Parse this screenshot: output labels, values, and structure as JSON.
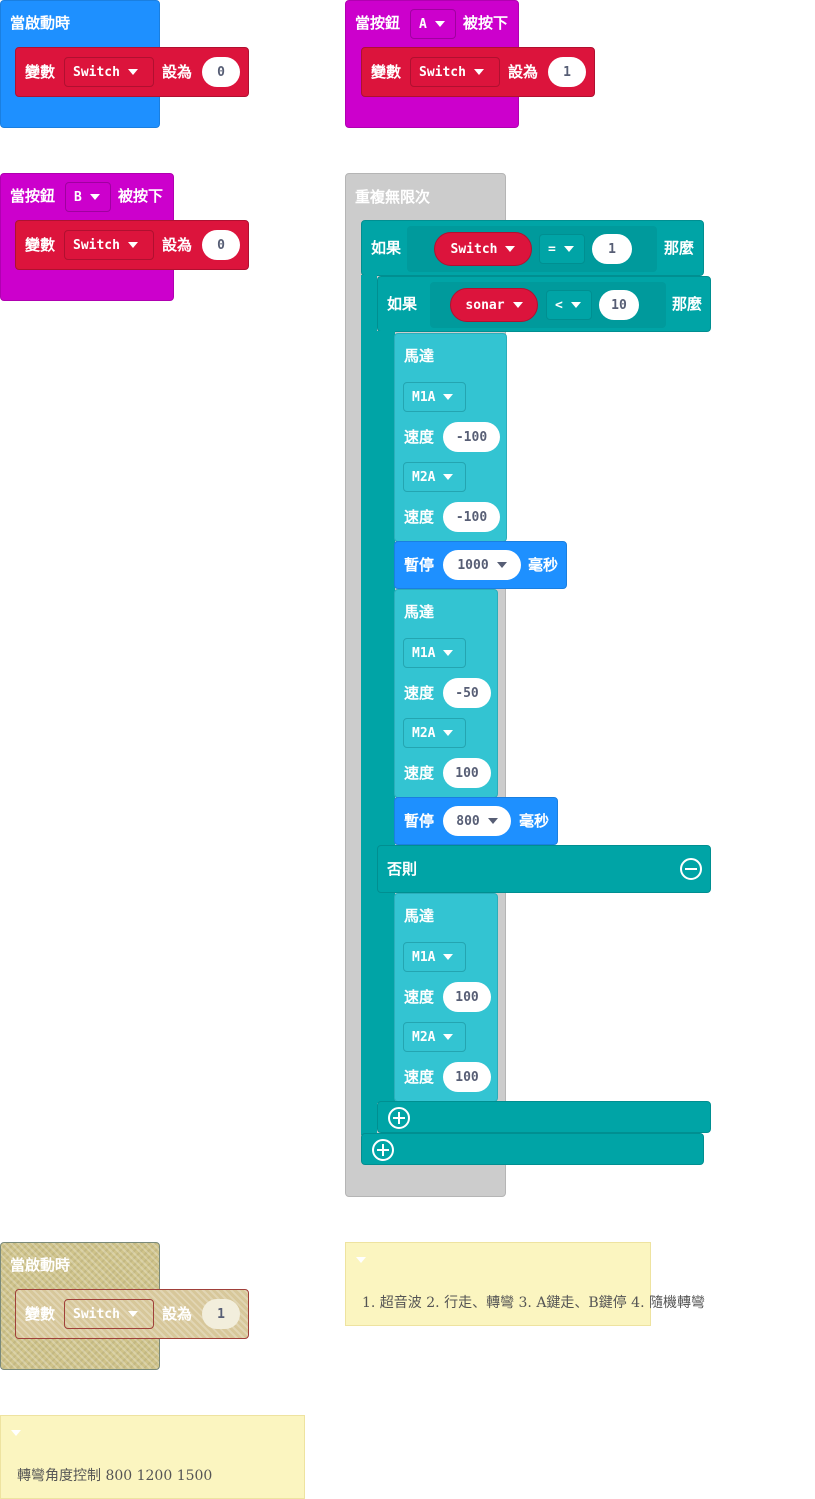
{
  "colors": {
    "event_blue": "#1e90ff",
    "event_magenta": "#cc00cc",
    "variable_red": "#dc143c",
    "loop_gray": "#cccccc",
    "logic_teal": "#00a4a6",
    "motor_cyan": "#33c4d2",
    "pause_blue": "#1e90ff",
    "comment_yellow": "#fbf5c0"
  },
  "blocks": {
    "on_start_1": {
      "label": "當啟動時",
      "set": {
        "var_label": "變數",
        "var_name": "Switch",
        "to_label": "設為",
        "value": "0"
      }
    },
    "on_button_a": {
      "label_pre": "當按鈕",
      "button": "A",
      "label_post": "被按下",
      "set": {
        "var_label": "變數",
        "var_name": "Switch",
        "to_label": "設為",
        "value": "1"
      }
    },
    "on_button_b": {
      "label_pre": "當按鈕",
      "button": "B",
      "label_post": "被按下",
      "set": {
        "var_label": "變數",
        "var_name": "Switch",
        "to_label": "設為",
        "value": "0"
      }
    },
    "forever": {
      "label": "重複無限次",
      "if_outer": {
        "if_label": "如果",
        "then_label": "那麼",
        "left": "Switch",
        "op": "=",
        "right": "1",
        "if_inner": {
          "if_label": "如果",
          "then_label": "那麼",
          "left": "sonar",
          "op": "<",
          "right": "10",
          "then": [
            {
              "type": "motor",
              "label": "馬達",
              "m1": "M1A",
              "speed_label": "速度",
              "s1": "-100",
              "m2": "M2A",
              "s2": "-100"
            },
            {
              "type": "pause",
              "label": "暫停",
              "ms": "1000",
              "unit": "毫秒"
            },
            {
              "type": "motor",
              "label": "馬達",
              "m1": "M1A",
              "speed_label": "速度",
              "s1": "-50",
              "m2": "M2A",
              "s2": "100"
            },
            {
              "type": "pause",
              "label": "暫停",
              "ms": "800",
              "unit": "毫秒"
            }
          ],
          "else_label": "否則",
          "else": [
            {
              "type": "motor",
              "label": "馬達",
              "m1": "M1A",
              "speed_label": "速度",
              "s1": "100",
              "m2": "M2A",
              "s2": "100"
            }
          ]
        }
      }
    },
    "on_start_disabled": {
      "label": "當啟動時",
      "set": {
        "var_label": "變數",
        "var_name": "Switch",
        "to_label": "設為",
        "value": "1"
      }
    }
  },
  "comments": [
    {
      "text": "1. 超音波 2. 行走、轉彎 3. A鍵走、B鍵停 4. 隨機轉彎"
    },
    {
      "text": "轉彎角度控制 800 1200 1500"
    }
  ]
}
